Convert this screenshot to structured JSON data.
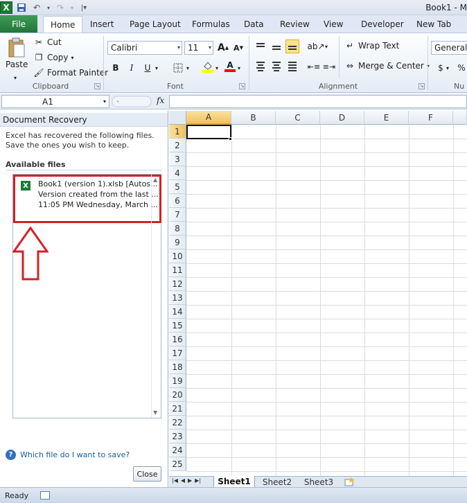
{
  "window": {
    "title": "Book1 - M"
  },
  "quick_access": {
    "icons": [
      "excel-icon",
      "save-icon",
      "undo-icon",
      "redo-icon",
      "customize-icon"
    ]
  },
  "tabs": {
    "file": "File",
    "items": [
      "Home",
      "Insert",
      "Page Layout",
      "Formulas",
      "Data",
      "Review",
      "View",
      "Developer",
      "New Tab"
    ],
    "active": "Home"
  },
  "ribbon": {
    "clipboard": {
      "paste": "Paste",
      "cut": "Cut",
      "copy": "Copy",
      "format_painter": "Format Painter",
      "label": "Clipboard"
    },
    "font": {
      "name": "Calibri",
      "size": "11",
      "bold": "B",
      "italic": "I",
      "underline": "U",
      "label": "Font",
      "fill_color": "#ffff00",
      "font_color": "#ff0000"
    },
    "alignment": {
      "wrap_text": "Wrap Text",
      "merge_center": "Merge & Center",
      "label": "Alignment"
    },
    "number": {
      "format": "General",
      "currency": "$",
      "percent": "%",
      "label": "Nu"
    }
  },
  "formula_bar": {
    "name_box": "A1",
    "fx": "fx",
    "value": ""
  },
  "recovery": {
    "title": "Document Recovery",
    "message": "Excel has recovered the following files.  Save the ones you wish to keep.",
    "available_label": "Available files",
    "files": [
      {
        "name": "Book1 (version 1).xlsb  [Autos...",
        "desc": "Version created from the last ...",
        "time": "11:05 PM Wednesday, March ..."
      }
    ],
    "help_link": "Which file do I want to save?",
    "close_button": "Close",
    "highlight_color": "#d22127"
  },
  "grid": {
    "columns": [
      "A",
      "B",
      "C",
      "D",
      "E",
      "F"
    ],
    "rows": [
      "1",
      "2",
      "3",
      "4",
      "5",
      "6",
      "7",
      "8",
      "9",
      "10",
      "11",
      "12",
      "13",
      "14",
      "15",
      "16",
      "17",
      "18",
      "19",
      "20",
      "21",
      "22",
      "23",
      "24",
      "25"
    ],
    "active_cell": "A1"
  },
  "sheets": {
    "items": [
      "Sheet1",
      "Sheet2",
      "Sheet3"
    ],
    "active": "Sheet1"
  },
  "status": {
    "text": "Ready"
  }
}
